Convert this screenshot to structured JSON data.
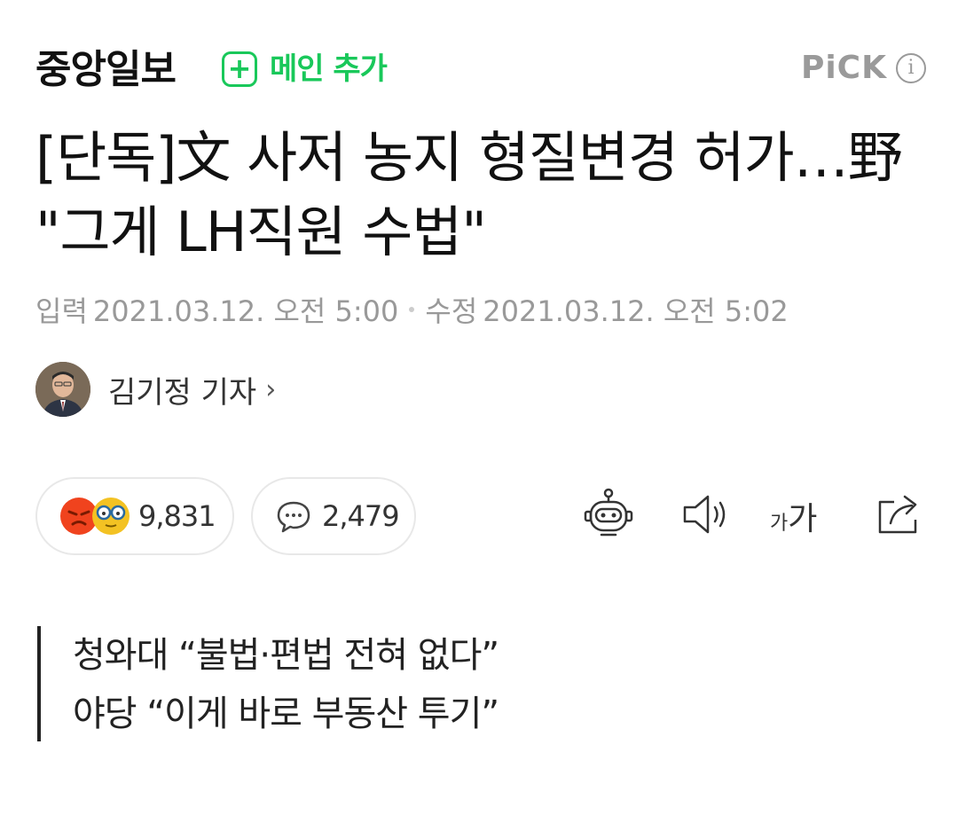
{
  "header": {
    "press_name": "중앙일보",
    "add_main_label": "메인 추가",
    "pick_label": "PiCK",
    "info_glyph": "i"
  },
  "article": {
    "title": "[단독]文 사저 농지 형질변경 허가…野 \"그게 LH직원 수법\"",
    "published_label": "입력",
    "published_at": "2021.03.12. 오전 5:00",
    "modified_label": "수정",
    "modified_at": "2021.03.12. 오전 5:02",
    "reporter": "김기정 기자",
    "reporter_chevron": "›"
  },
  "actions": {
    "reaction_count": "9,831",
    "comment_count": "2,479",
    "font_size_small": "가",
    "font_size_big": "가",
    "icons": [
      "angry-emoji-icon",
      "glasses-emoji-icon",
      "comment-bubble-icon",
      "robot-summary-icon",
      "speaker-icon",
      "font-size-icon",
      "share-icon"
    ]
  },
  "summary": {
    "lines": [
      "청와대 “불법·편법 전혀 없다”",
      "야당 “이게 바로 부동산 투기”"
    ]
  },
  "colors": {
    "accent_green": "#19c85a",
    "angry_red": "#f0431e",
    "glasses_yellow": "#f3c223",
    "meta_gray": "#999999"
  }
}
